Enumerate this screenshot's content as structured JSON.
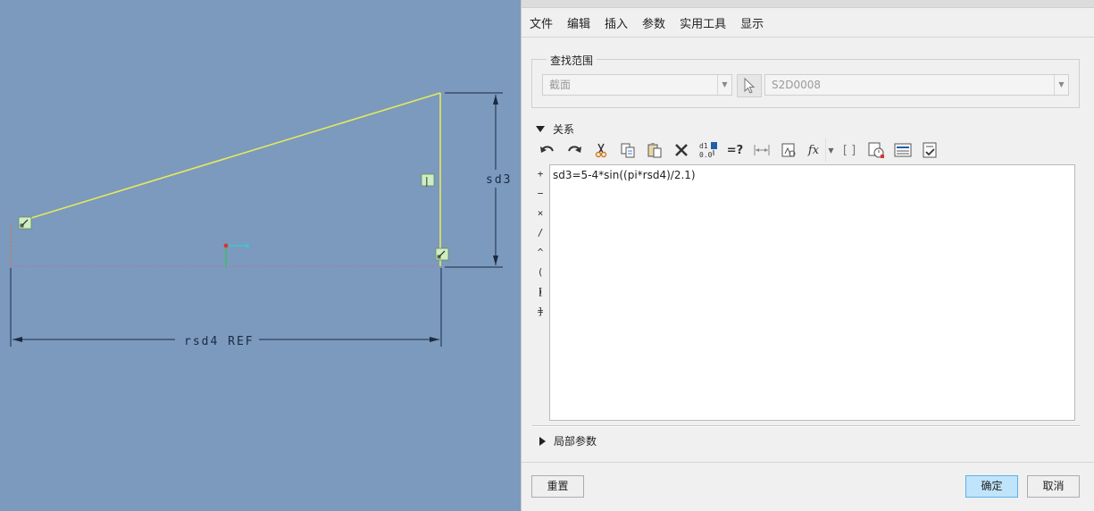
{
  "canvas": {
    "dimension_height_label": "sd3",
    "dimension_width_label": "rsd4 REF",
    "constraint_vertical": "|",
    "colors": {
      "background": "#7b9abe",
      "sketch_line": "#e8e85a",
      "dimension": "#1b2a40",
      "centerline": "#b07ab0"
    }
  },
  "dialog": {
    "menu": [
      "文件",
      "编辑",
      "插入",
      "参数",
      "实用工具",
      "显示"
    ],
    "scope": {
      "legend": "查找范围",
      "type_value": "截面",
      "object_value": "S2D0008"
    },
    "relations": {
      "title": "关系",
      "toolbar_icons": [
        "undo-icon",
        "redo-icon",
        "cut-icon",
        "copy-icon",
        "paste-icon",
        "delete-icon",
        "switch-dimensions-icon",
        "evaluate-icon",
        "insert-dimension-icon",
        "unit-sensitive-icon",
        "insert-function-icon",
        "insert-parameter-icon",
        "units-icon",
        "sort-icon",
        "verify-icon"
      ],
      "operators": [
        "+",
        "−",
        "×",
        "/",
        "^",
        "( )",
        "[ ]",
        "="
      ],
      "text": "sd3=5-4*sin((pi*rsd4)/2.1)"
    },
    "local_params": {
      "title": "局部参数"
    },
    "buttons": {
      "reset": "重置",
      "ok": "确定",
      "cancel": "取消"
    }
  }
}
